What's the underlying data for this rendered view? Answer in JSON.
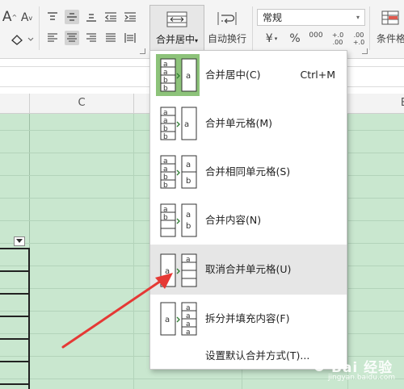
{
  "ribbon": {
    "font_size_increase": "A",
    "font_size_decrease": "A",
    "merge_label": "合并居中",
    "wrap_label": "自动换行",
    "number_format_value": "常规",
    "currency_symbol": "¥",
    "percent_symbol": "%",
    "thousands_symbol": "000",
    "increase_decimal": "+.0 .00",
    "decrease_decimal": ".00 +.0",
    "conditional_label": "条件格"
  },
  "sheet": {
    "column_c": "C",
    "column_e": "E"
  },
  "menu": {
    "items": [
      {
        "label": "合并居中(C)",
        "shortcut": "Ctrl+M"
      },
      {
        "label": "合并单元格(M)"
      },
      {
        "label": "合并相同单元格(S)"
      },
      {
        "label": "合并内容(N)"
      },
      {
        "label": "取消合并单元格(U)"
      },
      {
        "label": "拆分并填充内容(F)"
      },
      {
        "label": "设置默认合并方式(T)..."
      }
    ]
  },
  "watermark": {
    "text": "Bai 经验",
    "sub": "jingyan.baidu.com"
  },
  "colors": {
    "grid_green": "#c9e7cf",
    "highlight_green": "#8dc37a",
    "arrow_red": "#e53935",
    "hover_grey": "#e6e6e6"
  }
}
